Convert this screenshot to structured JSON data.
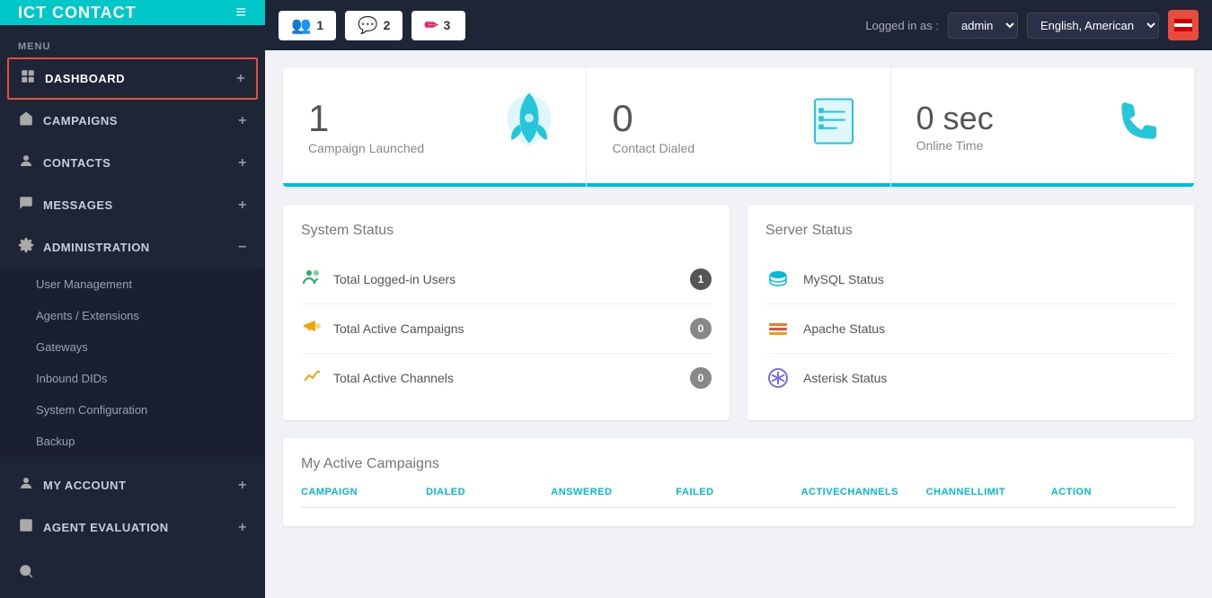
{
  "brand": {
    "name": "ICT CONTACT"
  },
  "sidebar": {
    "menu_label": "MENU",
    "items": [
      {
        "id": "dashboard",
        "label": "DASHBOARD",
        "icon": "👤",
        "plus": "+",
        "active": true
      },
      {
        "id": "campaigns",
        "label": "CAMPAIGNS",
        "icon": "📣",
        "plus": "+"
      },
      {
        "id": "contacts",
        "label": "CONTACTS",
        "icon": "👥",
        "plus": "+"
      },
      {
        "id": "messages",
        "label": "MESSAGES",
        "icon": "💬",
        "plus": "+"
      },
      {
        "id": "administration",
        "label": "ADMINISTRATION",
        "icon": "⚙",
        "minus": "−"
      }
    ],
    "submenu": [
      {
        "id": "user-management",
        "label": "User Management"
      },
      {
        "id": "agents-extensions",
        "label": "Agents / Extensions"
      },
      {
        "id": "gateways",
        "label": "Gateways"
      },
      {
        "id": "inbound-dids",
        "label": "Inbound DIDs"
      },
      {
        "id": "system-configuration",
        "label": "System Configuration"
      },
      {
        "id": "backup",
        "label": "Backup"
      }
    ],
    "bottom_items": [
      {
        "id": "my-account",
        "label": "MY ACCOUNT",
        "plus": "+"
      },
      {
        "id": "agent-evaluation",
        "label": "AGENT EVALUATION",
        "plus": "+"
      }
    ]
  },
  "navbar": {
    "tabs": [
      {
        "id": "tab1",
        "number": "1",
        "icon": "👥",
        "icon_color": "green"
      },
      {
        "id": "tab2",
        "number": "2",
        "icon": "💬",
        "icon_color": "teal"
      },
      {
        "id": "tab3",
        "number": "3",
        "icon": "✏",
        "icon_color": "pink"
      }
    ],
    "logged_in_label": "Logged in as :",
    "user": "admin",
    "language": "English, American",
    "flag_icon": "🚩"
  },
  "stats": [
    {
      "id": "campaign-launched",
      "number": "1",
      "label": "Campaign Launched",
      "icon": "rocket"
    },
    {
      "id": "contact-dialed",
      "number": "0",
      "label": "Contact Dialed",
      "icon": "list"
    },
    {
      "id": "online-time",
      "number": "0 sec",
      "label": "Online Time",
      "icon": "phone"
    }
  ],
  "system_status": {
    "title": "System Status",
    "rows": [
      {
        "id": "logged-users",
        "label": "Total Logged-in Users",
        "count": "1",
        "icon": "users"
      },
      {
        "id": "active-campaigns",
        "label": "Total Active Campaigns",
        "count": "0",
        "icon": "megaphone"
      },
      {
        "id": "active-channels",
        "label": "Total Active Channels",
        "count": "0",
        "icon": "chart"
      }
    ]
  },
  "server_status": {
    "title": "Server Status",
    "rows": [
      {
        "id": "mysql",
        "label": "MySQL Status",
        "icon": "db"
      },
      {
        "id": "apache",
        "label": "Apache Status",
        "icon": "server"
      },
      {
        "id": "asterisk",
        "label": "Asterisk Status",
        "icon": "asterisk"
      }
    ]
  },
  "active_campaigns": {
    "title": "My Active Campaigns",
    "columns": [
      "CAMPAIGN",
      "DIALED",
      "ANSWERED",
      "FAILED",
      "ACTIVECHANNELS",
      "CHANNELLIMIT",
      "ACTION"
    ]
  }
}
